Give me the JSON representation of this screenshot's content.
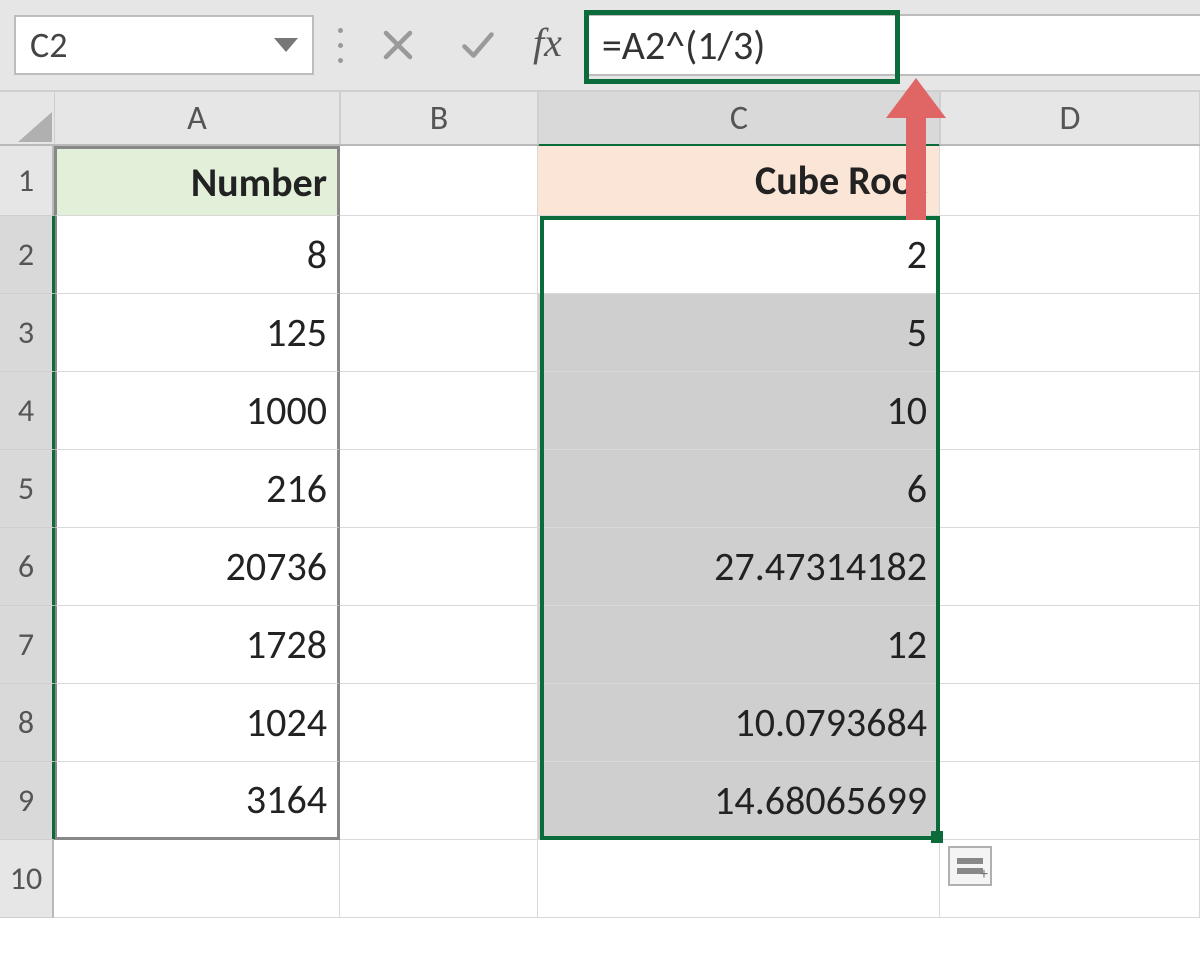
{
  "formula_bar": {
    "active_cell_ref": "C2",
    "formula": "=A2^(1/3)",
    "fx_label": "fx"
  },
  "columns": {
    "A": "A",
    "B": "B",
    "C": "C",
    "D": "D"
  },
  "row_numbers": [
    "1",
    "2",
    "3",
    "4",
    "5",
    "6",
    "7",
    "8",
    "9",
    "10"
  ],
  "headers": {
    "A": "Number",
    "C": "Cube Root"
  },
  "data": {
    "A": [
      "8",
      "125",
      "1000",
      "216",
      "20736",
      "1728",
      "1024",
      "3164"
    ],
    "C": [
      "2",
      "5",
      "10",
      "6",
      "27.47314182",
      "12",
      "10.0793684",
      "14.68065699"
    ]
  },
  "chart_data": {
    "type": "table",
    "title": "Cube Root",
    "columns": [
      "Number",
      "Cube Root"
    ],
    "rows": [
      [
        8,
        2
      ],
      [
        125,
        5
      ],
      [
        1000,
        10
      ],
      [
        216,
        6
      ],
      [
        20736,
        27.47314182
      ],
      [
        1728,
        12
      ],
      [
        1024,
        10.0793684
      ],
      [
        3164,
        14.68065699
      ]
    ],
    "formula": "=A2^(1/3)"
  }
}
